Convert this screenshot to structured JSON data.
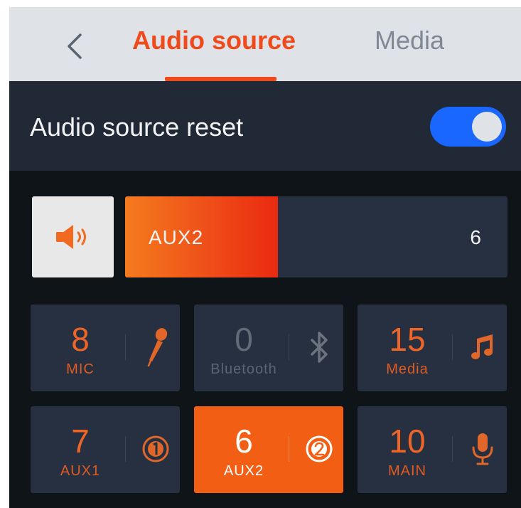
{
  "header": {
    "back_icon": "chevron-left-icon",
    "tabs": [
      {
        "label": "Audio source",
        "active": true
      },
      {
        "label": "Media",
        "active": false
      }
    ]
  },
  "reset": {
    "label": "Audio source reset",
    "enabled": true
  },
  "current": {
    "name": "AUX2",
    "value": "6",
    "level_fraction": 0.4,
    "icon": "speaker-icon"
  },
  "tiles": [
    {
      "value": "8",
      "label": "MIC",
      "icon": "microphone-handheld-icon",
      "state": "normal"
    },
    {
      "value": "0",
      "label": "Bluetooth",
      "icon": "bluetooth-icon",
      "state": "disabled"
    },
    {
      "value": "15",
      "label": "Media",
      "icon": "music-note-icon",
      "state": "normal"
    },
    {
      "value": "7",
      "label": "AUX1",
      "icon": "aux1-icon",
      "state": "normal"
    },
    {
      "value": "6",
      "label": "AUX2",
      "icon": "aux2-icon",
      "state": "active"
    },
    {
      "value": "10",
      "label": "MAIN",
      "icon": "microphone-icon",
      "state": "normal"
    }
  ],
  "colors": {
    "accent": "#ee4a1c",
    "toggle_on": "#1967ff",
    "tile_bg": "#263040",
    "tile_active": "#f25e14"
  }
}
